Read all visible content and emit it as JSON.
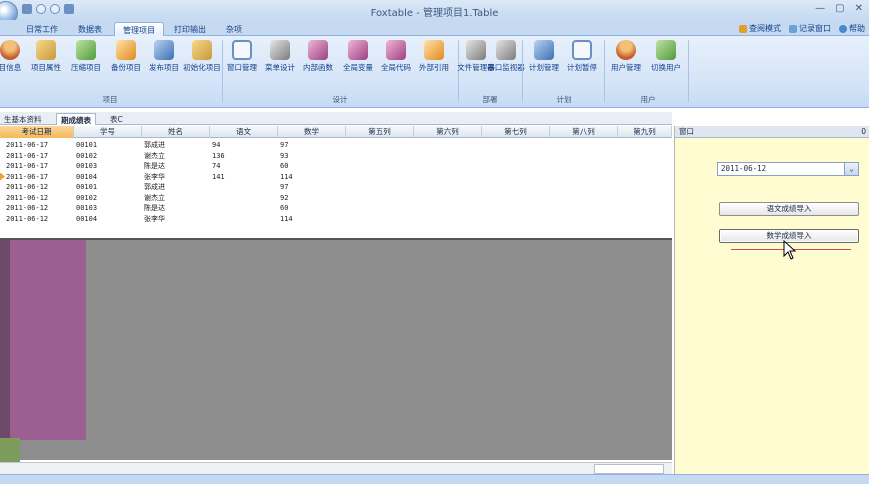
{
  "window": {
    "title": "Foxtable - 管理项目1.Table"
  },
  "winbtns": [
    "—",
    "▢",
    "✕"
  ],
  "ribbon_tabs": [
    "日常工作",
    "数据表",
    "管理项目",
    "打印输出",
    "杂项"
  ],
  "right_links": [
    "查阅模式",
    "记录窗口",
    "帮助"
  ],
  "ribbon": {
    "buttons": [
      "目信息",
      "项目属性",
      "压缩项目",
      "备份项目",
      "发布项目",
      "初始化项目",
      "窗口管理",
      "菜单设计",
      "内部函数",
      "全局变量",
      "全局代码",
      "外部引用",
      "文件管理器",
      "串口监视器",
      "计划管理",
      "计划暂停",
      "用户管理",
      "切换用户"
    ],
    "groups": [
      "项目",
      "设计",
      "部署",
      "计划",
      "用户"
    ]
  },
  "sheet_tabs": [
    "生基本资料",
    "期成绩表",
    "表C"
  ],
  "grid": {
    "columns": [
      "考试日期",
      "学号",
      "姓名",
      "语文",
      "数学",
      "第五列",
      "第六列",
      "第七列",
      "第八列",
      "第九列"
    ],
    "rows": [
      [
        "2011-06-17",
        "00101",
        "郭成进",
        "94",
        "97"
      ],
      [
        "2011-06-17",
        "00102",
        "谢杰立",
        "136",
        "93"
      ],
      [
        "2011-06-17",
        "00103",
        "陈是达",
        "74",
        "60"
      ],
      [
        "2011-06-17",
        "00104",
        "张李华",
        "141",
        "114"
      ],
      [
        "2011-06-12",
        "00101",
        "郭成进",
        "",
        "97"
      ],
      [
        "2011-06-12",
        "00102",
        "谢杰立",
        "",
        "92"
      ],
      [
        "2011-06-12",
        "00103",
        "陈是达",
        "",
        "60"
      ],
      [
        "2011-06-12",
        "00104",
        "张李华",
        "",
        "114"
      ]
    ]
  },
  "panel": {
    "header": "窗口",
    "header_num": "0",
    "date_value": "2011-06-12",
    "btn_chinese": "语文成绩导入",
    "btn_math": "数学成绩导入"
  }
}
